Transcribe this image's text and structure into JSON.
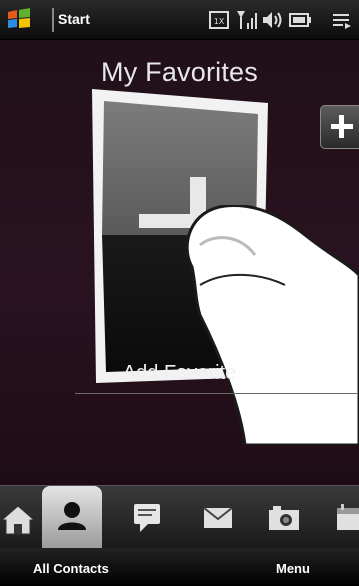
{
  "status_bar": {
    "start_label": "Start",
    "icons": [
      "windows-logo",
      "notification-icon",
      "signal-icon",
      "volume-icon",
      "battery-icon",
      "menu-icon"
    ]
  },
  "main": {
    "title": "My Favorites",
    "add_favorite_label": "Add Favorite",
    "side_button": "+"
  },
  "tabs": [
    {
      "name": "home",
      "icon": "home-icon",
      "active": false
    },
    {
      "name": "people",
      "icon": "person-icon",
      "active": true
    },
    {
      "name": "messages",
      "icon": "message-icon",
      "active": false
    },
    {
      "name": "email",
      "icon": "envelope-icon",
      "active": false
    },
    {
      "name": "photos",
      "icon": "camera-icon",
      "active": false
    },
    {
      "name": "calendar",
      "icon": "calendar-icon",
      "active": false
    }
  ],
  "softkeys": {
    "left": "All Contacts",
    "right": "Menu"
  },
  "colors": {
    "background": "#24101b",
    "active_tab": "#d0d0d0"
  }
}
